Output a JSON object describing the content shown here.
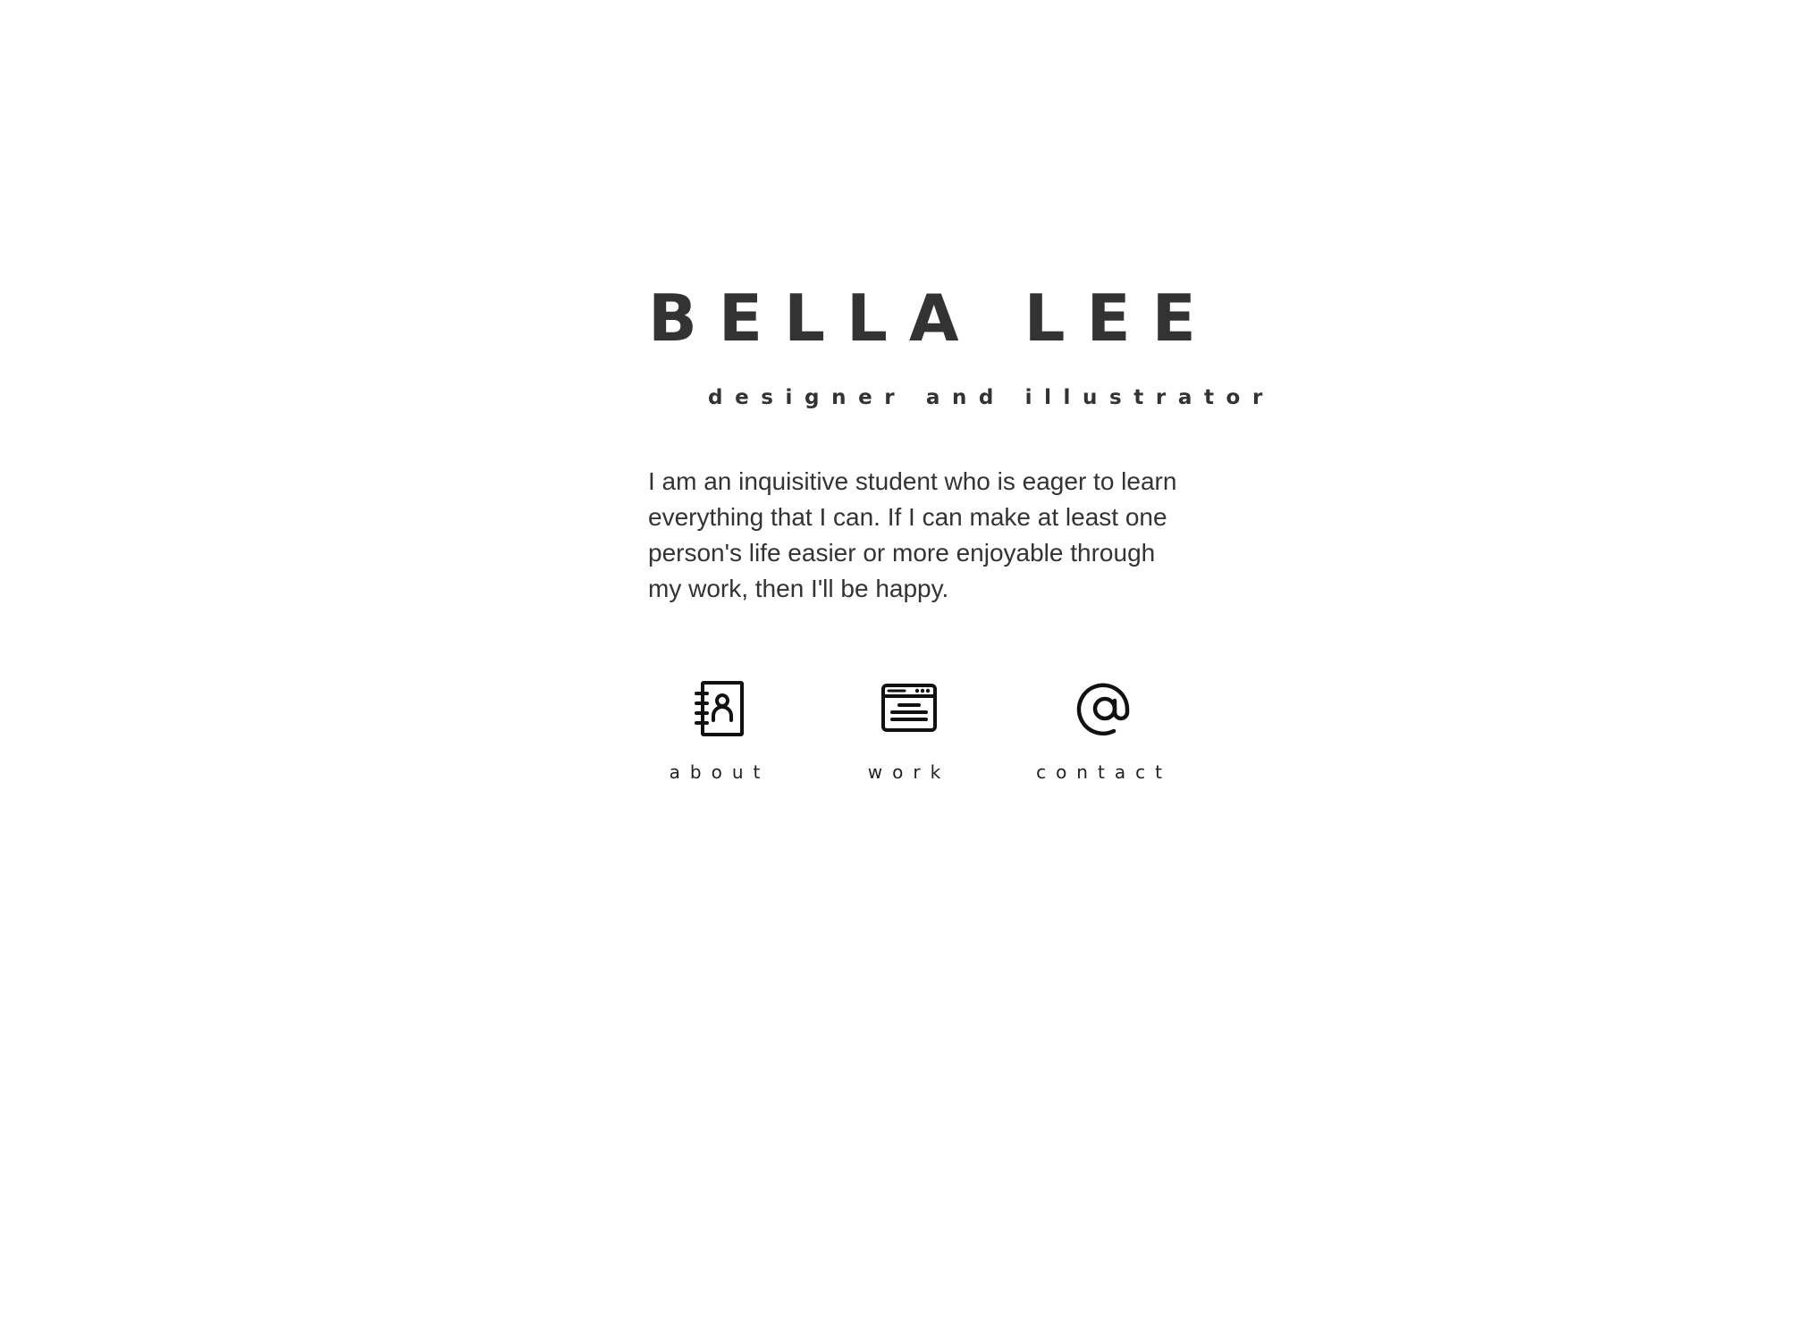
{
  "header": {
    "name": "BELLA LEE",
    "subtitle": "designer and illustrator"
  },
  "bio": {
    "text": "I am an inquisitive student who is eager to learn everything that I can. If I can make at least one person's life easier or more enjoyable through my work, then I'll be happy."
  },
  "nav": {
    "items": [
      {
        "label": "about",
        "icon": "address-book-icon"
      },
      {
        "label": "work",
        "icon": "browser-window-icon"
      },
      {
        "label": "contact",
        "icon": "at-sign-icon"
      }
    ]
  },
  "colors": {
    "text": "#333333",
    "icon": "#111111",
    "background": "#ffffff"
  }
}
